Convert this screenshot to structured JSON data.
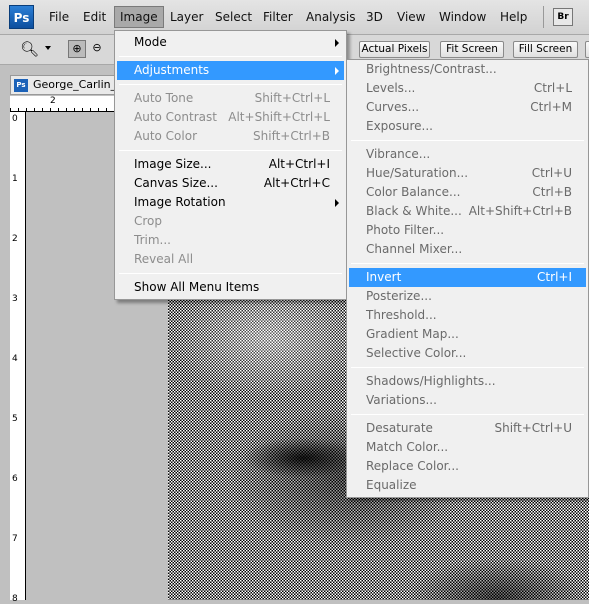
{
  "app": {
    "logo": "Ps",
    "bridge": "Br"
  },
  "menubar": [
    "File",
    "Edit",
    "Image",
    "Layer",
    "Select",
    "Filter",
    "Analysis",
    "3D",
    "View",
    "Window",
    "Help"
  ],
  "menubar_active": "Image",
  "options_bar": {
    "buttons": [
      "Actual Pixels",
      "Fit Screen",
      "Fill Screen"
    ]
  },
  "document": {
    "tab_title": "George_Carlin_",
    "tab_icon": "Ps",
    "ruler_top": [
      "2"
    ],
    "ruler_left": [
      "0",
      "1",
      "2",
      "3",
      "4",
      "5",
      "6",
      "7",
      "8"
    ]
  },
  "image_menu": [
    {
      "label": "Mode",
      "submenu": true
    },
    {
      "sep": true
    },
    {
      "label": "Adjustments",
      "submenu": true,
      "highlighted": true
    },
    {
      "sep": true
    },
    {
      "label": "Auto Tone",
      "shortcut": "Shift+Ctrl+L",
      "disabled": true
    },
    {
      "label": "Auto Contrast",
      "shortcut": "Alt+Shift+Ctrl+L",
      "disabled": true
    },
    {
      "label": "Auto Color",
      "shortcut": "Shift+Ctrl+B",
      "disabled": true
    },
    {
      "sep": true
    },
    {
      "label": "Image Size...",
      "shortcut": "Alt+Ctrl+I"
    },
    {
      "label": "Canvas Size...",
      "shortcut": "Alt+Ctrl+C"
    },
    {
      "label": "Image Rotation",
      "submenu": true
    },
    {
      "label": "Crop",
      "disabled": true
    },
    {
      "label": "Trim...",
      "disabled": true
    },
    {
      "label": "Reveal All",
      "disabled": true
    },
    {
      "sep": true
    },
    {
      "label": "Show All Menu Items"
    }
  ],
  "adjustments_menu": [
    {
      "label": "Brightness/Contrast..."
    },
    {
      "label": "Levels...",
      "shortcut": "Ctrl+L"
    },
    {
      "label": "Curves...",
      "shortcut": "Ctrl+M"
    },
    {
      "label": "Exposure..."
    },
    {
      "sep": true
    },
    {
      "label": "Vibrance..."
    },
    {
      "label": "Hue/Saturation...",
      "shortcut": "Ctrl+U"
    },
    {
      "label": "Color Balance...",
      "shortcut": "Ctrl+B"
    },
    {
      "label": "Black & White...",
      "shortcut": "Alt+Shift+Ctrl+B"
    },
    {
      "label": "Photo Filter..."
    },
    {
      "label": "Channel Mixer..."
    },
    {
      "sep": true
    },
    {
      "label": "Invert",
      "shortcut": "Ctrl+I",
      "highlighted": true
    },
    {
      "label": "Posterize..."
    },
    {
      "label": "Threshold..."
    },
    {
      "label": "Gradient Map..."
    },
    {
      "label": "Selective Color..."
    },
    {
      "sep": true
    },
    {
      "label": "Shadows/Highlights..."
    },
    {
      "label": "Variations..."
    },
    {
      "sep": true
    },
    {
      "label": "Desaturate",
      "shortcut": "Shift+Ctrl+U"
    },
    {
      "label": "Match Color..."
    },
    {
      "label": "Replace Color..."
    },
    {
      "label": "Equalize"
    }
  ],
  "colors": {
    "highlight": "#3399ff",
    "menu_bg": "#f0f0f0",
    "canvas_bg": "#c0c0c0"
  }
}
